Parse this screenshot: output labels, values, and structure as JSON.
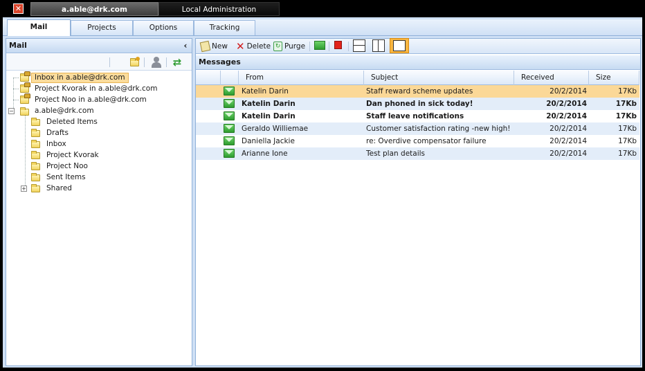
{
  "window": {
    "account_tab": "a.able@drk.com",
    "admin_tab": "Local Administration"
  },
  "tabs": [
    {
      "label": "Mail"
    },
    {
      "label": "Projects"
    },
    {
      "label": "Options"
    },
    {
      "label": "Tracking"
    }
  ],
  "left": {
    "title": "Mail",
    "collapse_glyph": "‹",
    "tree": {
      "accounts": [
        "Inbox in a.able@drk.com",
        "Project Kvorak in a.able@drk.com",
        "Project Noo in a.able@drk.com"
      ],
      "root": "a.able@drk.com",
      "folders": [
        "Deleted Items",
        "Drafts",
        "Inbox",
        "Project Kvorak",
        "Project Noo",
        "Sent Items",
        "Shared"
      ]
    }
  },
  "toolbar": {
    "new": "New",
    "delete": "Delete",
    "purge": "Purge"
  },
  "messages": {
    "title": "Messages",
    "columns": {
      "from": "From",
      "subject": "Subject",
      "received": "Received",
      "size": "Size"
    },
    "rows": [
      {
        "from": "Katelin Darin",
        "subject": "Staff reward scheme updates",
        "received": "20/2/2014",
        "size": "17Kb"
      },
      {
        "from": "Katelin Darin",
        "subject": "Dan phoned in sick today!",
        "received": "20/2/2014",
        "size": "17Kb"
      },
      {
        "from": "Katelin Darin",
        "subject": "Staff leave notifications",
        "received": "20/2/2014",
        "size": "17Kb"
      },
      {
        "from": "Geraldo Williemae",
        "subject": "Customer satisfaction rating -new high!",
        "received": "20/2/2014",
        "size": "17Kb"
      },
      {
        "from": "Daniella Jackie",
        "subject": "re: Overdive compensator failure",
        "received": "20/2/2014",
        "size": "17Kb"
      },
      {
        "from": "Arianne Ione",
        "subject": "Test plan details",
        "received": "20/2/2014",
        "size": "17Kb"
      }
    ]
  },
  "colors": {
    "frame": "#cfe0f5",
    "selected_row": "#fbd897",
    "alt_row": "#e3edf9",
    "close_button": "#d9452c"
  }
}
